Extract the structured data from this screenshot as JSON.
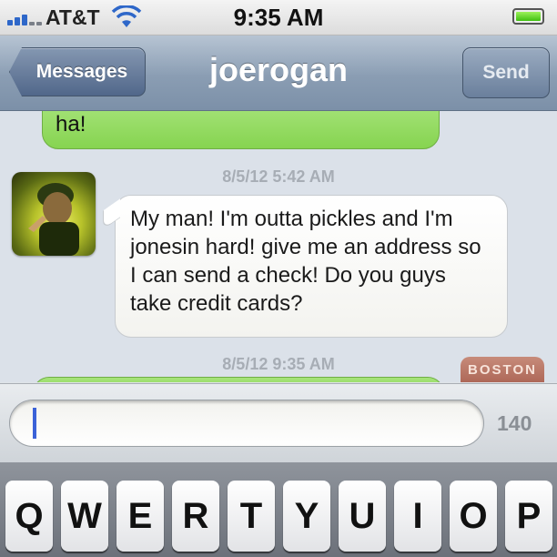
{
  "status_bar": {
    "carrier": "AT&T",
    "time": "9:35 AM",
    "icons": [
      "signal-icon",
      "wifi-icon",
      "battery-icon"
    ]
  },
  "nav": {
    "back_label": "Messages",
    "title": "joerogan",
    "send_label": "Send"
  },
  "conversation": {
    "messages": [
      {
        "from": "me",
        "text": "ha!"
      },
      {
        "timestamp": "8/5/12 5:42 AM",
        "from": "joerogan",
        "text": "My man! I'm outta pickles and I'm jonesin hard! give me an address so I can send a check! Do you guys take credit cards?"
      },
      {
        "timestamp": "8/5/12 9:35 AM",
        "from": "me",
        "text": ""
      }
    ],
    "avatar_badge_text": "BOSTON"
  },
  "input_bar": {
    "value": "",
    "char_count": "140"
  },
  "keyboard": {
    "row1": [
      "Q",
      "W",
      "E",
      "R",
      "T",
      "Y",
      "U",
      "I",
      "O",
      "P"
    ]
  },
  "colors": {
    "nav_bar": "#8a9db3",
    "sent_bubble": "#8fd65a",
    "received_bubble": "#ffffff",
    "cursor": "#3b62d8"
  }
}
